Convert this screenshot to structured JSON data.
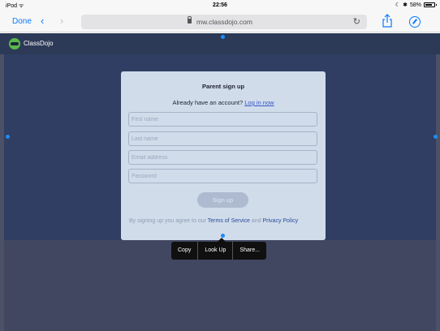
{
  "status_bar": {
    "carrier": "iPod",
    "time": "22:56",
    "battery": "58%"
  },
  "toolbar": {
    "done_label": "Done",
    "url": "mw.classdojo.com"
  },
  "app": {
    "title": "ClassDojo"
  },
  "modal": {
    "title": "Parent sign up",
    "login_prompt": "Already have an account?",
    "login_link": "Log in now",
    "fields": {
      "first_name_placeholder": "First name",
      "last_name_placeholder": "Last name",
      "email_placeholder": "Email address",
      "password_placeholder": "Password"
    },
    "signup_label": "Sign up",
    "terms_prefix": "By signing up you agree to our",
    "terms_link": "Terms of Service",
    "terms_and": "and",
    "privacy_link": "Privacy Policy"
  },
  "callout": {
    "items": [
      "Copy",
      "Look Up",
      "Share..."
    ]
  },
  "colors": {
    "accent": "#0a7aff",
    "header": "#2d3a57",
    "overlay": "#2f3e62",
    "modal": "#d0dcea",
    "link": "#3758c9",
    "selection": "#1f8cf5"
  }
}
